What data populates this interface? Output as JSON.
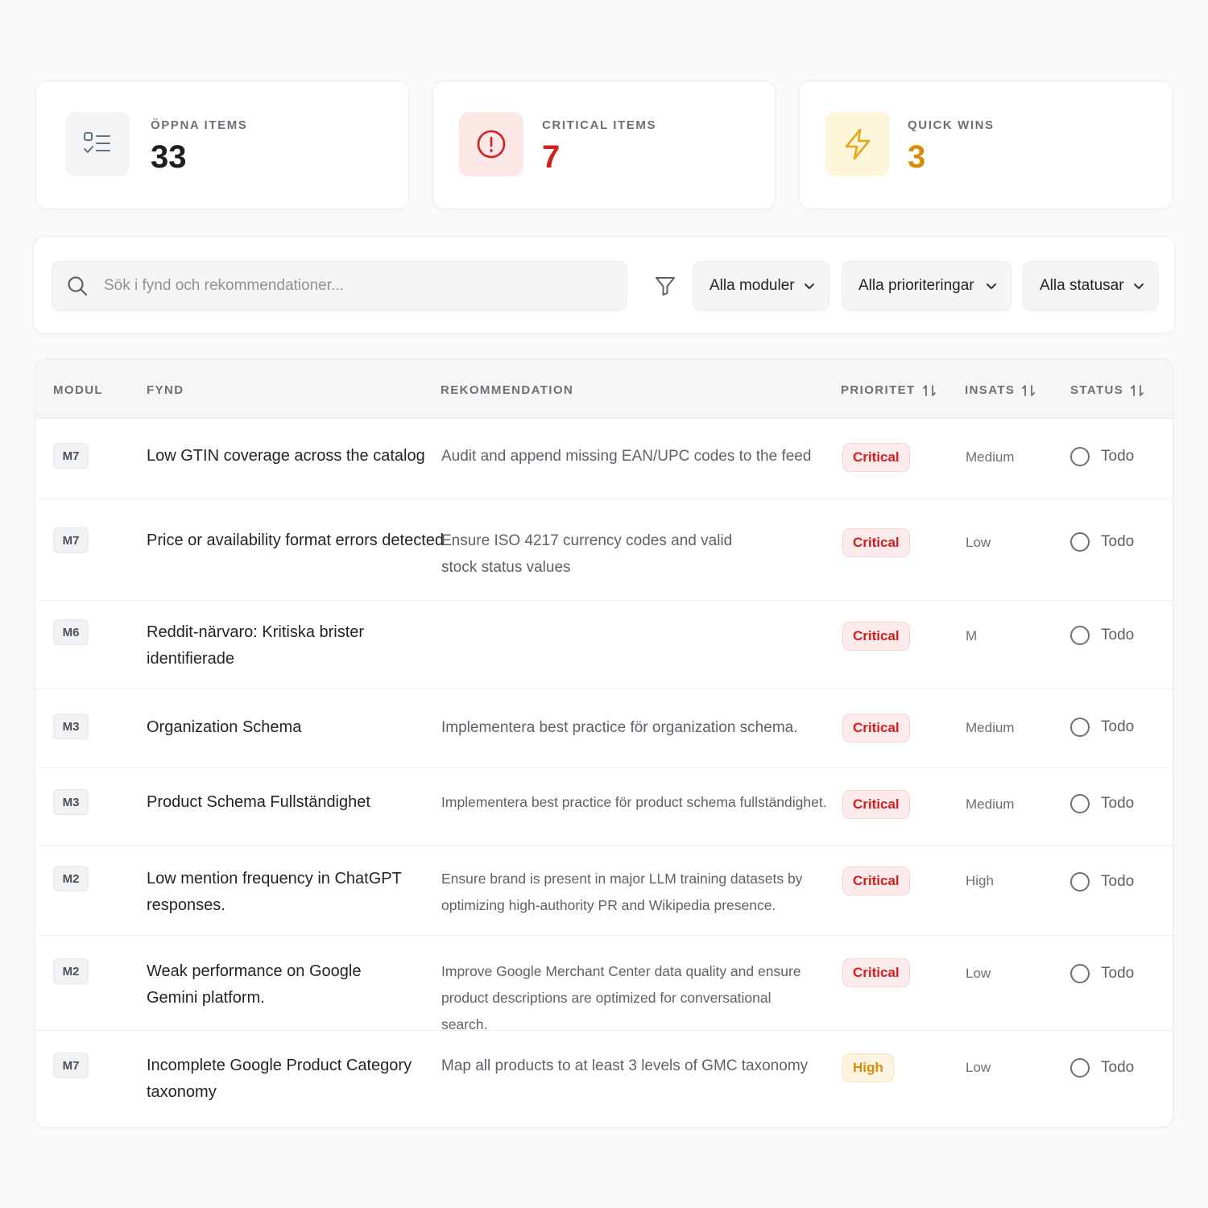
{
  "stats": {
    "open": {
      "label": "ÖPPNA ITEMS",
      "value": "33",
      "icon": "checklist-icon"
    },
    "critical": {
      "label": "CRITICAL ITEMS",
      "value": "7",
      "icon": "alert-circle-icon",
      "color": "#d11f1f"
    },
    "quick": {
      "label": "QUICK WINS",
      "value": "3",
      "icon": "lightning-icon",
      "color": "#d98c0a"
    }
  },
  "filters": {
    "search_placeholder": "Sök i fynd och rekommendationer...",
    "module": "Alla moduler",
    "priority": "Alla prioriteringar",
    "status": "Alla statusar"
  },
  "table": {
    "headers": {
      "modul": "MODUL",
      "fynd": "FYND",
      "rekommendation": "REKOMMENDATION",
      "prioritet": "PRIORITET",
      "insats": "INSATS",
      "status": "STATUS"
    },
    "rows": [
      {
        "modul": "M7",
        "fynd": "Low GTIN coverage across the catalog",
        "rekommendation": "Audit and append missing EAN/UPC codes to the feed",
        "prioritet": "Critical",
        "insats": "Medium",
        "status": "Todo"
      },
      {
        "modul": "M7",
        "fynd": "Price or availability format errors detected",
        "rekommendation": "Ensure ISO 4217 currency codes and valid stock status values",
        "prioritet": "Critical",
        "insats": "Low",
        "status": "Todo"
      },
      {
        "modul": "M6",
        "fynd": "Reddit-närvaro: Kritiska brister identifierade",
        "rekommendation": "",
        "prioritet": "Critical",
        "insats": "M",
        "status": "Todo"
      },
      {
        "modul": "M3",
        "fynd": "Organization Schema",
        "rekommendation": "Implementera best practice för organization schema.",
        "prioritet": "Critical",
        "insats": "Medium",
        "status": "Todo"
      },
      {
        "modul": "M3",
        "fynd": "Product Schema Fullständighet",
        "rekommendation": "Implementera best practice för product schema fullständighet.",
        "prioritet": "Critical",
        "insats": "Medium",
        "status": "Todo"
      },
      {
        "modul": "M2",
        "fynd": "Low mention frequency in ChatGPT responses.",
        "rekommendation": "Ensure brand is present in major LLM training datasets by optimizing high-authority PR and Wikipedia presence.",
        "prioritet": "Critical",
        "insats": "High",
        "status": "Todo"
      },
      {
        "modul": "M2",
        "fynd": "Weak performance on Google Gemini platform.",
        "rekommendation": "Improve Google Merchant Center data quality and ensure product descriptions are optimized for conversational search.",
        "prioritet": "Critical",
        "insats": "Low",
        "status": "Todo"
      },
      {
        "modul": "M7",
        "fynd": "Incomplete Google Product Category taxonomy",
        "rekommendation": "Map all products to at least 3 levels of GMC taxonomy",
        "prioritet": "High",
        "insats": "Low",
        "status": "Todo"
      }
    ]
  }
}
